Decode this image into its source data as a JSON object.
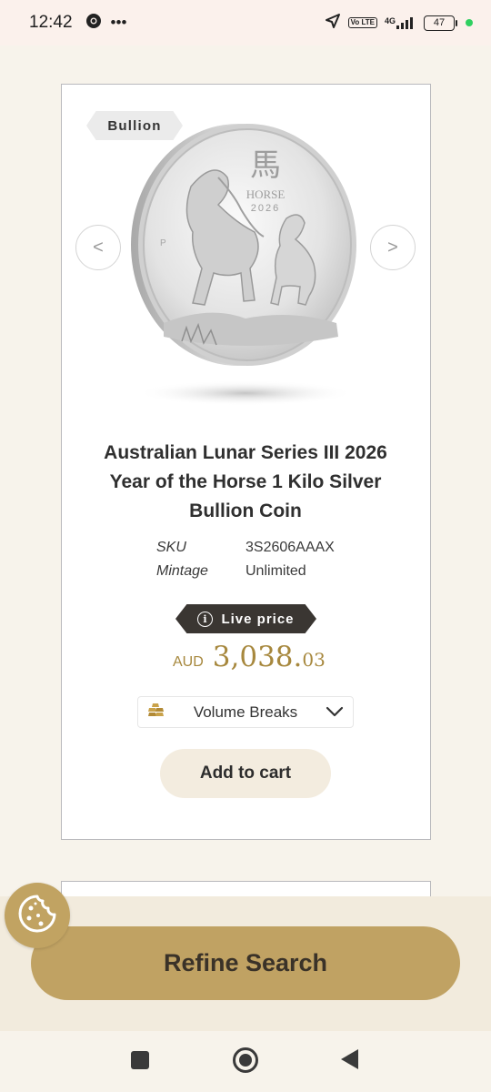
{
  "status_bar": {
    "time": "12:42",
    "network": "4G",
    "volte": "Vo LTE",
    "battery": "47"
  },
  "product": {
    "badge": "Bullion",
    "title": "Australian Lunar Series III 2026 Year of the Horse 1 Kilo Silver Bullion Coin",
    "coin_image": {
      "chinese_char": "馬",
      "word": "HORSE",
      "year": "2026",
      "mint_mark": "P"
    },
    "specs": [
      {
        "label": "SKU",
        "value": "3S2606AAAX"
      },
      {
        "label": "Mintage",
        "value": "Unlimited"
      }
    ],
    "live_price_label": "Live price",
    "price": {
      "currency": "AUD",
      "main": "3,038.",
      "cents": "03"
    },
    "volume_breaks_label": "Volume Breaks",
    "add_to_cart_label": "Add to cart"
  },
  "refine_search_label": "Refine Search",
  "icons": {
    "prev": "chevron-left-icon",
    "next": "chevron-right-icon",
    "info": "info-icon",
    "gold_bars": "gold-bars-icon",
    "dropdown": "chevron-down-icon",
    "cookie": "cookie-icon"
  },
  "colors": {
    "accent_gold": "#c0a263",
    "price_gold": "#a7883e",
    "live_price_bg": "#3a3632",
    "page_bg": "#f7f3eb"
  }
}
